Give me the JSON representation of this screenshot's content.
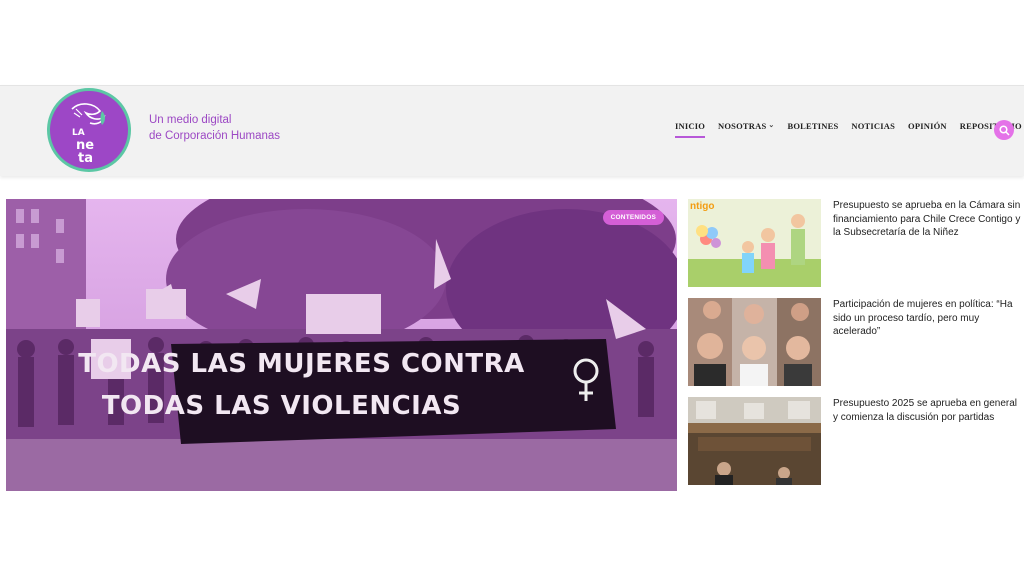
{
  "header": {
    "tagline_line1": "Un medio digital",
    "tagline_line2": "de Corporación Humanas",
    "logo_text": "LA neta"
  },
  "nav": {
    "items": [
      {
        "label": "INICIO",
        "active": true,
        "dropdown": false
      },
      {
        "label": "NOSOTRAS",
        "active": false,
        "dropdown": true
      },
      {
        "label": "BOLETINES",
        "active": false,
        "dropdown": false
      },
      {
        "label": "NOTICIAS",
        "active": false,
        "dropdown": false
      },
      {
        "label": "OPINIÓN",
        "active": false,
        "dropdown": false
      },
      {
        "label": "REPOSITORIO",
        "active": false,
        "dropdown": true
      }
    ],
    "search_icon": "search-icon"
  },
  "hero": {
    "badge": "CONTENIDOS",
    "banner_line1": "TODAS LAS MUJERES CONTRA",
    "banner_line2": "TODAS LAS VIOLENCIAS"
  },
  "side_articles": [
    {
      "title": "Presupuesto se aprueba en la Cámara sin financiamiento para Chile Crece Contigo y la Subsecretaría de la Niñez",
      "thumb_text": "ntigo"
    },
    {
      "title": "Participación de mujeres en política: “Ha sido un proceso tardío, pero muy acelerado”"
    },
    {
      "title": "Presupuesto 2025 se aprueba en general y comienza la discusión por partidas"
    }
  ],
  "colors": {
    "brand_purple": "#9d47c6",
    "brand_green": "#5cc7a5",
    "accent_pink": "#e472e8",
    "header_bg": "#f2f2f2"
  }
}
